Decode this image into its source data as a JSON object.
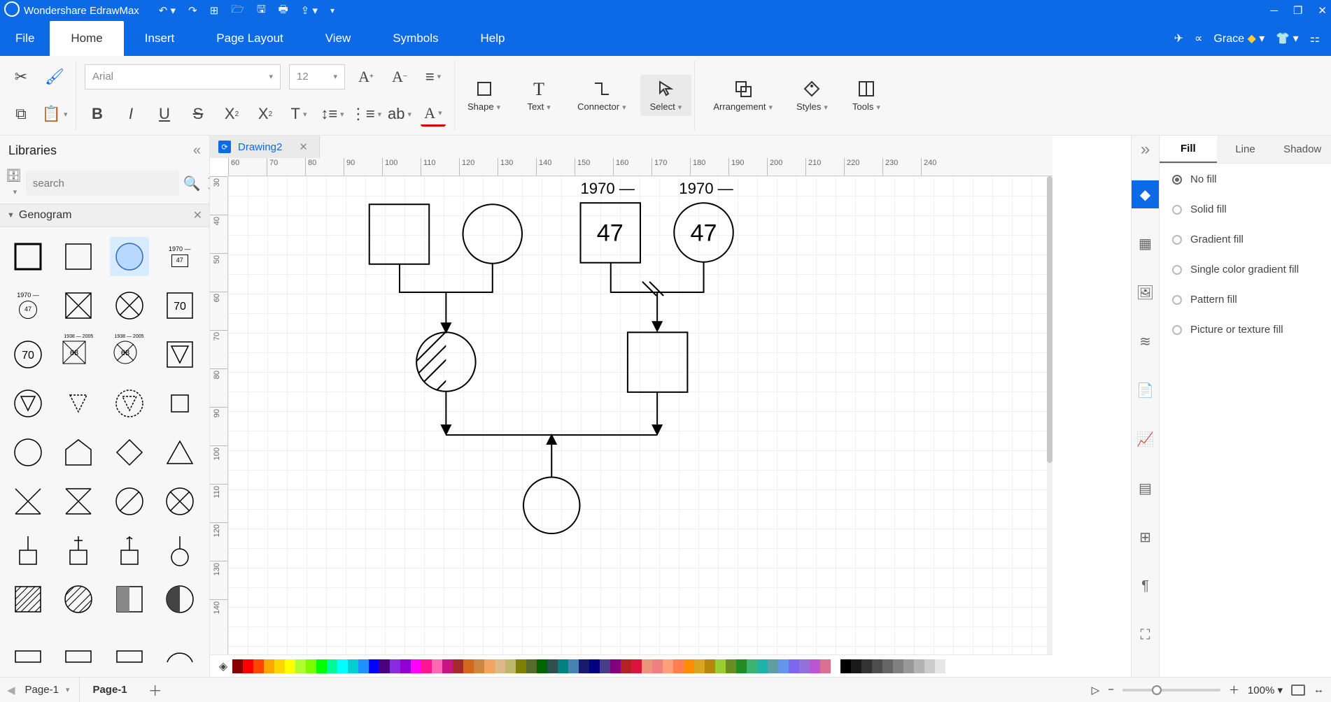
{
  "titlebar": {
    "app": "Wondershare EdrawMax"
  },
  "menubar": {
    "tabs": [
      "File",
      "Home",
      "Insert",
      "Page Layout",
      "View",
      "Symbols",
      "Help"
    ],
    "user": "Grace"
  },
  "ribbon": {
    "font": "Arial",
    "size": "12",
    "shape": "Shape",
    "text": "Text",
    "connector": "Connector",
    "select": "Select",
    "arrangement": "Arrangement",
    "styles": "Styles",
    "tools": "Tools"
  },
  "libraries": {
    "title": "Libraries",
    "search_ph": "search",
    "section": "Genogram",
    "shape_year": "1970",
    "shape_age": "47",
    "shape_age2": "70",
    "shape_dates": "1938 — 2005",
    "shape_deadage": "68"
  },
  "doctab": {
    "name": "Drawing2"
  },
  "canvas": {
    "year_left": "1970 —",
    "year_right": "1970 —",
    "age_left": "47",
    "age_right": "47",
    "ruler_h": [
      "60",
      "70",
      "80",
      "90",
      "100",
      "110",
      "120",
      "130",
      "140",
      "150",
      "160",
      "170",
      "180",
      "190",
      "200",
      "210",
      "220",
      "230",
      "240"
    ],
    "ruler_v": [
      "30",
      "40",
      "50",
      "60",
      "70",
      "80",
      "90",
      "100",
      "110",
      "120",
      "130",
      "140"
    ]
  },
  "rightpanel": {
    "tabs": [
      "Fill",
      "Line",
      "Shadow"
    ],
    "opts": [
      "No fill",
      "Solid fill",
      "Gradient fill",
      "Single color gradient fill",
      "Pattern fill",
      "Picture or texture fill"
    ]
  },
  "status": {
    "pagesel": "Page-1",
    "pagetab": "Page-1",
    "zoom": "100%"
  }
}
